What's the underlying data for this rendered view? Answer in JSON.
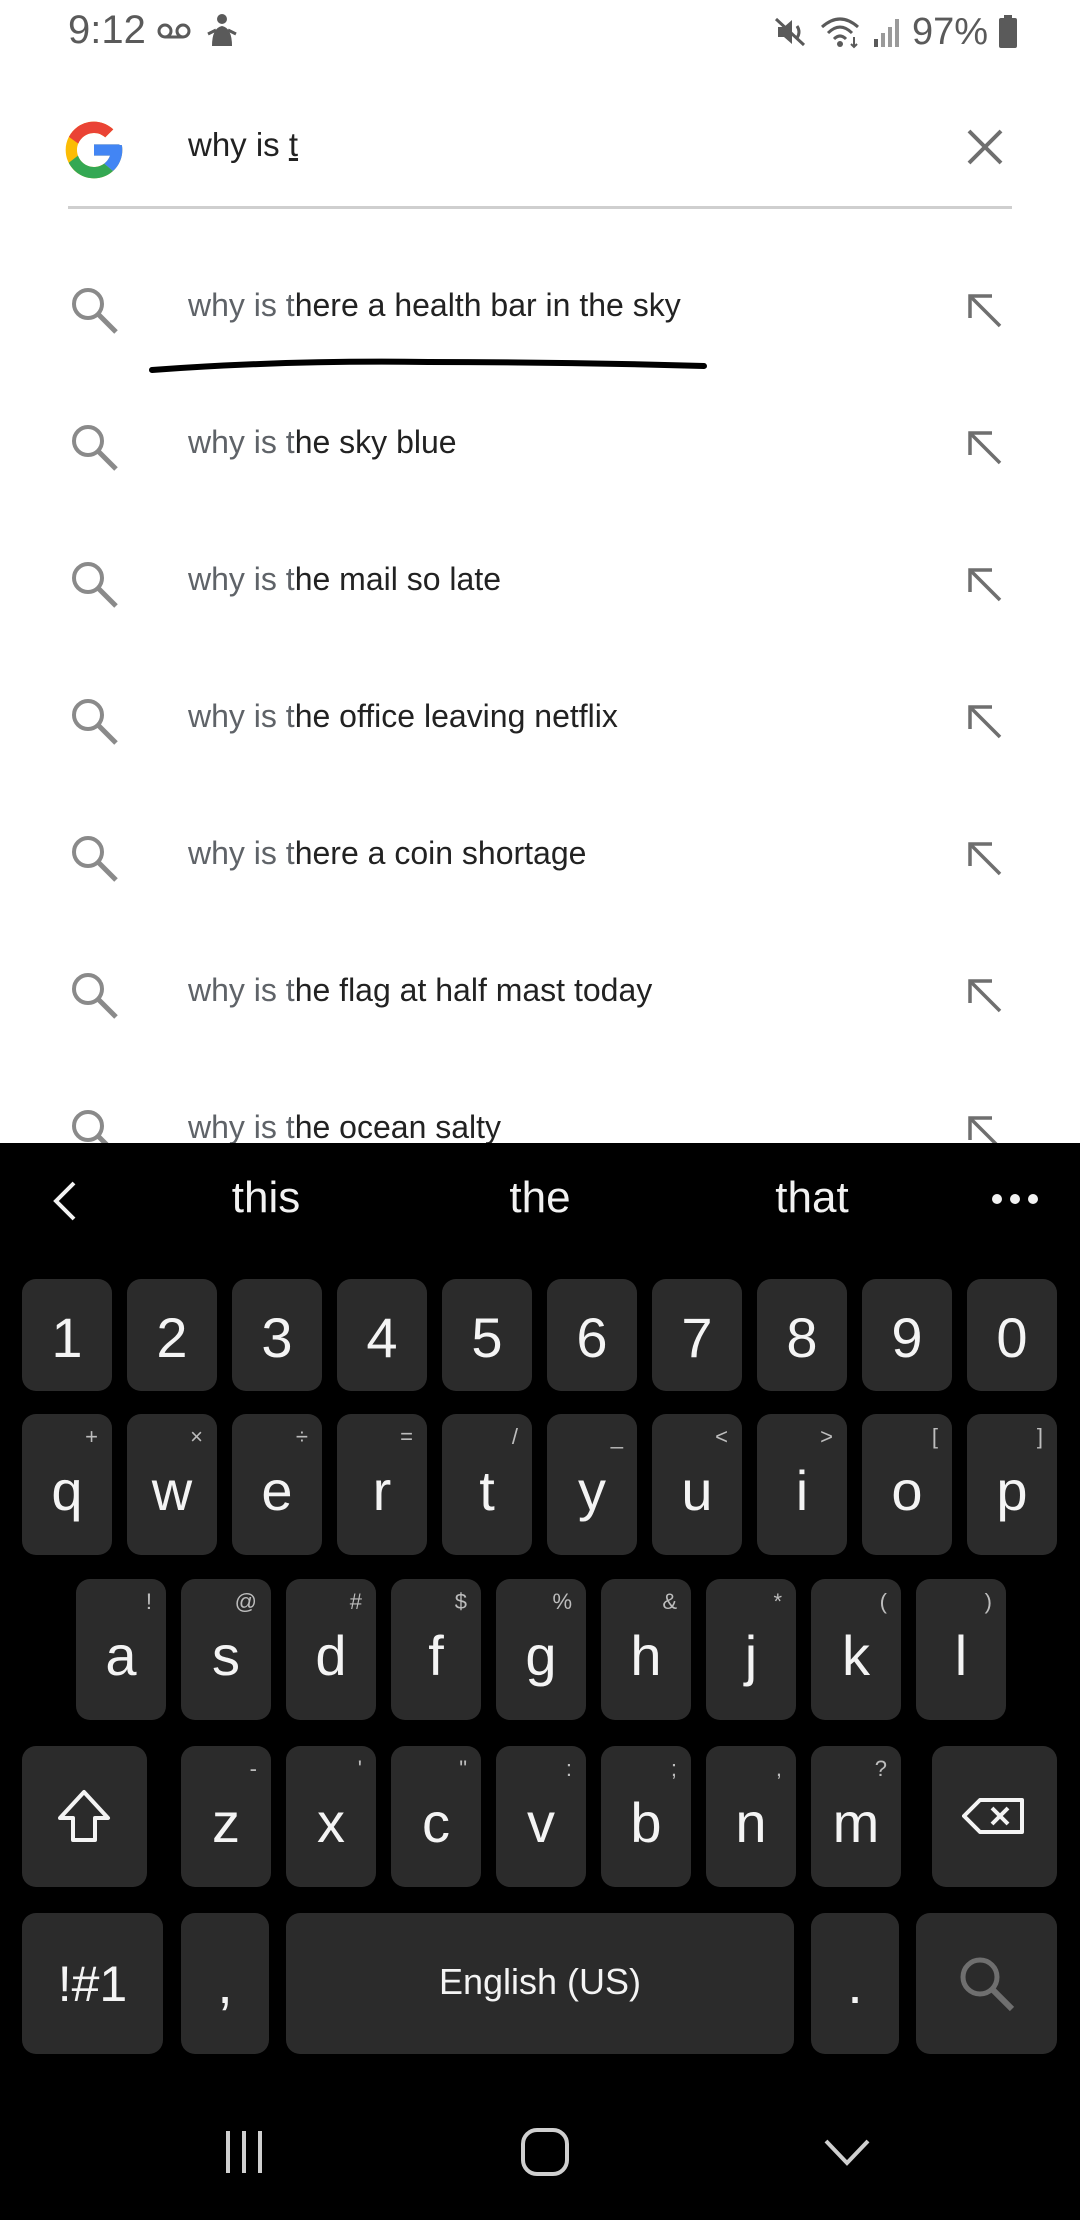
{
  "status_bar": {
    "time": "9:12",
    "battery_percent": "97%",
    "icons": [
      "voicemail-icon",
      "person-icon",
      "mute-icon",
      "wifi-icon",
      "signal-icon",
      "battery-icon"
    ]
  },
  "search": {
    "query_prefix": "why is ",
    "query_typed": "t",
    "logo": "google-g-logo",
    "clear_icon": "close-icon"
  },
  "suggestions": [
    {
      "prefix": "why is t",
      "rest": "here a health bar in the sky"
    },
    {
      "prefix": "why is t",
      "rest": "he sky blue"
    },
    {
      "prefix": "why is t",
      "rest": "he mail so late"
    },
    {
      "prefix": "why is t",
      "rest": "he office leaving netflix"
    },
    {
      "prefix": "why is t",
      "rest": "here a coin shortage"
    },
    {
      "prefix": "why is t",
      "rest": "he flag at half mast today"
    },
    {
      "prefix": "why is t",
      "rest": "he ocean salty"
    }
  ],
  "keyboard": {
    "predictions": [
      "this",
      "the",
      "that"
    ],
    "number_row": [
      "1",
      "2",
      "3",
      "4",
      "5",
      "6",
      "7",
      "8",
      "9",
      "0"
    ],
    "row1": [
      {
        "k": "q",
        "s": "+"
      },
      {
        "k": "w",
        "s": "×"
      },
      {
        "k": "e",
        "s": "÷"
      },
      {
        "k": "r",
        "s": "="
      },
      {
        "k": "t",
        "s": "/"
      },
      {
        "k": "y",
        "s": "_"
      },
      {
        "k": "u",
        "s": "<"
      },
      {
        "k": "i",
        "s": ">"
      },
      {
        "k": "o",
        "s": "["
      },
      {
        "k": "p",
        "s": "]"
      }
    ],
    "row2": [
      {
        "k": "a",
        "s": "!"
      },
      {
        "k": "s",
        "s": "@"
      },
      {
        "k": "d",
        "s": "#"
      },
      {
        "k": "f",
        "s": "$"
      },
      {
        "k": "g",
        "s": "%"
      },
      {
        "k": "h",
        "s": "&"
      },
      {
        "k": "j",
        "s": "*"
      },
      {
        "k": "k",
        "s": "("
      },
      {
        "k": "l",
        "s": ")"
      }
    ],
    "row3": [
      {
        "k": "z",
        "s": "-"
      },
      {
        "k": "x",
        "s": "'"
      },
      {
        "k": "c",
        "s": "\""
      },
      {
        "k": "v",
        "s": ":"
      },
      {
        "k": "b",
        "s": ";"
      },
      {
        "k": "n",
        "s": ","
      },
      {
        "k": "m",
        "s": "?"
      }
    ],
    "symbols_label": "!#1",
    "comma": ",",
    "space_label": "English (US)",
    "period": "."
  },
  "colors": {
    "keyboard_bg": "#000000",
    "key_bg": "#2b2b2b",
    "key_text": "#f4f4f4",
    "icon_gray": "#6f6f6f",
    "google_blue": "#4285F4",
    "google_red": "#EA4335",
    "google_yellow": "#FBBC05",
    "google_green": "#34A853"
  }
}
